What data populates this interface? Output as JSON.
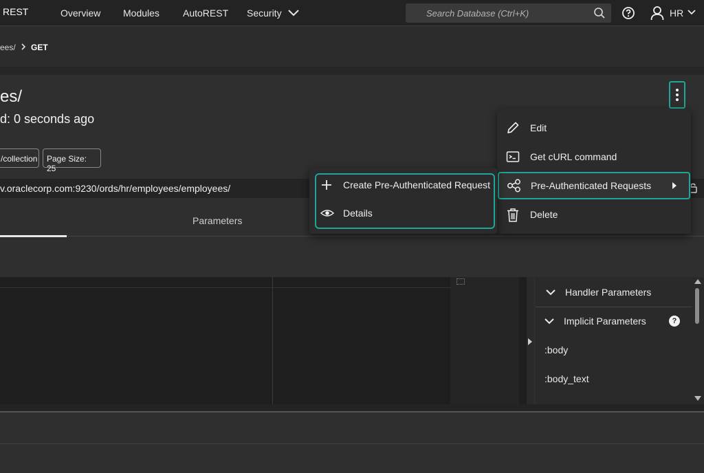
{
  "nav": {
    "brand": "REST",
    "items": [
      "Overview",
      "Modules",
      "AutoREST",
      "Security"
    ],
    "search_placeholder": "Search Database (Ctrl+K)",
    "user": "HR"
  },
  "breadcrumb": {
    "parent": "ees/",
    "current": "GET"
  },
  "header": {
    "title": "es/",
    "subtitle": "d: 0 seconds ago",
    "chips": [
      "/collection",
      "Page Size: 25"
    ],
    "url": "v.oraclecorp.com:9230/ords/hr/employees/employees/"
  },
  "tabs": {
    "parameters": "Parameters"
  },
  "side_panel": {
    "handler_parameters": "Handler Parameters",
    "implicit_parameters": "Implicit Parameters",
    "help": "?",
    "items": [
      ":body",
      ":body_text"
    ]
  },
  "menu": {
    "items": [
      {
        "label": "Edit",
        "icon": "pencil-icon"
      },
      {
        "label": "Get cURL command",
        "icon": "terminal-icon"
      },
      {
        "label": "Pre-Authenticated Requests",
        "icon": "share-icon"
      },
      {
        "label": "Delete",
        "icon": "trash-icon"
      }
    ]
  },
  "submenu": {
    "items": [
      {
        "label": "Create Pre-Authenticated Request",
        "icon": "plus-icon"
      },
      {
        "label": "Details",
        "icon": "eye-icon"
      }
    ]
  },
  "colors": {
    "accent": "#1fa59a",
    "nav_bg": "#232323",
    "panel_bg": "#2f2f2f",
    "editor_bg": "#1e1e1e"
  }
}
